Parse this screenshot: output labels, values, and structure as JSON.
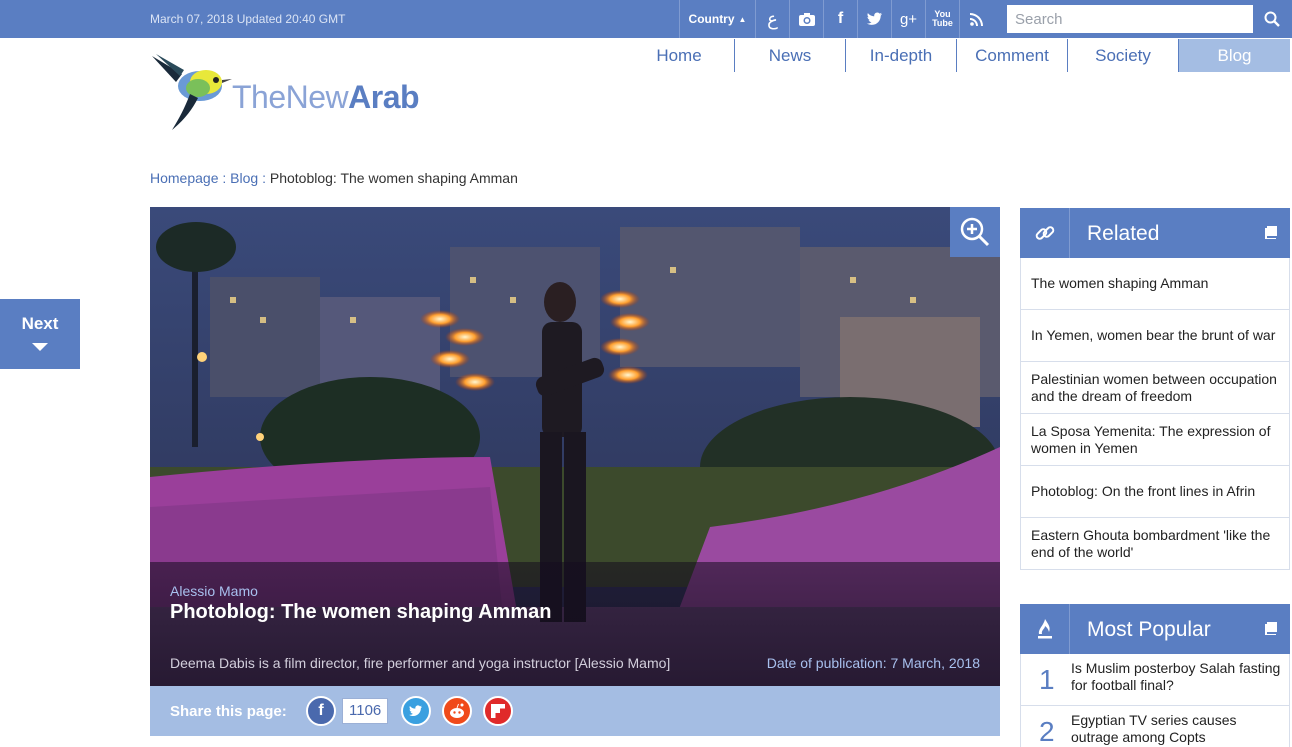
{
  "topbar": {
    "date": "March 07, 2018 Updated 20:40 GMT",
    "country_label": "Country",
    "arabic_label": "ع",
    "search_placeholder": "Search"
  },
  "logo": {
    "text_light": "TheNew",
    "text_bold": "Arab"
  },
  "nav": [
    {
      "label": "Home"
    },
    {
      "label": "News"
    },
    {
      "label": "In-depth"
    },
    {
      "label": "Comment"
    },
    {
      "label": "Society"
    },
    {
      "label": "Blog",
      "active": true
    }
  ],
  "breadcrumb": {
    "home": "Homepage",
    "sep1": " : ",
    "section": "Blog",
    "sep2": " : ",
    "current": "Photoblog: The women shaping Amman"
  },
  "next_tab": {
    "label": "Next"
  },
  "hero": {
    "author": "Alessio Mamo",
    "title": "Photoblog: The women shaping Amman",
    "caption": "Deema Dabis is a film director, fire performer and yoga instructor [Alessio Mamo]",
    "pub_date": "Date of publication: 7 March, 2018"
  },
  "share": {
    "label": "Share this page:",
    "facebook_count": "1106"
  },
  "related": {
    "title": "Related",
    "items": [
      "The women shaping Amman",
      "In Yemen, women bear the brunt of war",
      "Palestinian women between occupation and the dream of freedom",
      "La Sposa Yemenita: The expression of women in Yemen",
      "Photoblog: On the front lines in Afrin",
      "Eastern Ghouta bombardment 'like the end of the world'"
    ]
  },
  "popular": {
    "title": "Most Popular",
    "items": [
      {
        "num": "1",
        "text": "Is Muslim posterboy Salah fasting for football final?"
      },
      {
        "num": "2",
        "text": "Egyptian TV series causes outrage among Copts"
      }
    ]
  },
  "colors": {
    "brand_blue": "#5a7ec2",
    "light_blue": "#a4bde3"
  }
}
